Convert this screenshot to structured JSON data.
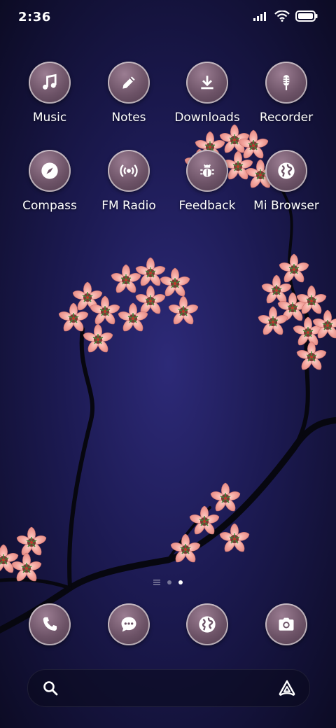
{
  "status_bar": {
    "time": "2:36",
    "icons": [
      "signal-icon",
      "wifi-icon",
      "battery-icon"
    ]
  },
  "apps": [
    {
      "label": "Music",
      "icon": "music-note-icon"
    },
    {
      "label": "Notes",
      "icon": "pencil-icon"
    },
    {
      "label": "Downloads",
      "icon": "download-icon"
    },
    {
      "label": "Recorder",
      "icon": "microphone-icon"
    },
    {
      "label": "Compass",
      "icon": "compass-icon"
    },
    {
      "label": "FM Radio",
      "icon": "radio-broadcast-icon"
    },
    {
      "label": "Feedback",
      "icon": "bug-icon"
    },
    {
      "label": "Mi Browser",
      "icon": "globe-icon"
    }
  ],
  "page_indicator": {
    "pages": 2,
    "active_page": 2,
    "has_app_list_icon": true
  },
  "dock": [
    {
      "icon": "phone-icon"
    },
    {
      "icon": "message-icon"
    },
    {
      "icon": "globe-icon"
    },
    {
      "icon": "camera-icon"
    }
  ],
  "search_bar": {
    "left_icon": "search-icon",
    "right_icon": "assistant-icon"
  },
  "colors": {
    "background": "#1c1a52",
    "icon_fill": "#6c5266",
    "blossom": "#f0a4a0",
    "branch": "#0a0a12"
  }
}
